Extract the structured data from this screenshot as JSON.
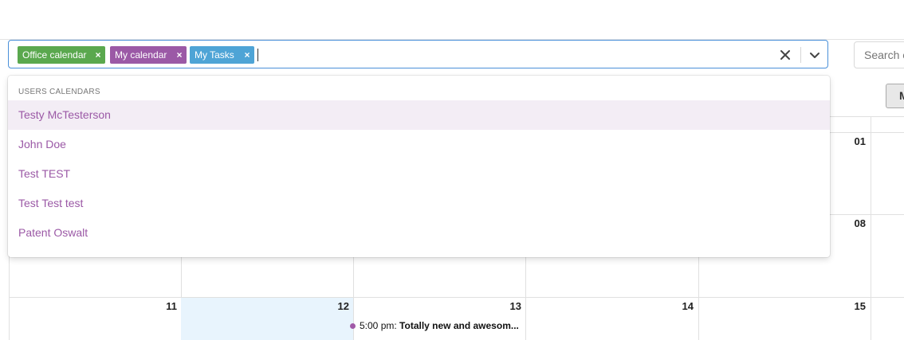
{
  "select": {
    "tags": [
      {
        "label": "Office calendar",
        "color": "#5aa84e"
      },
      {
        "label": "My calendar",
        "color": "#9b59a6"
      },
      {
        "label": "My Tasks",
        "color": "#4ea4d6"
      }
    ],
    "remove_glyph": "×",
    "icons": {
      "clear": "close-icon",
      "toggle": "chevron-down-icon"
    },
    "border_color": "#4a90d9"
  },
  "search": {
    "placeholder": "Search e"
  },
  "view_button": {
    "label": "M"
  },
  "dropdown": {
    "group_label": "USERS CALENDARS",
    "options": [
      {
        "label": "Testy McTesterson",
        "focused": true
      },
      {
        "label": "John Doe"
      },
      {
        "label": "Test TEST"
      },
      {
        "label": "Test Test test"
      },
      {
        "label": "Patent Oswalt"
      }
    ],
    "option_color": "#9b59a6",
    "focused_bg": "#f3edf5"
  },
  "calendar": {
    "day_numbers": [
      "01",
      "08",
      "11",
      "12",
      "13",
      "14",
      "15"
    ],
    "today": "12",
    "today_bg": "#e8f4fd",
    "event": {
      "time": "5:00 pm:",
      "title": "Totally new and awesom...",
      "dot_color": "#a15aa8"
    }
  }
}
